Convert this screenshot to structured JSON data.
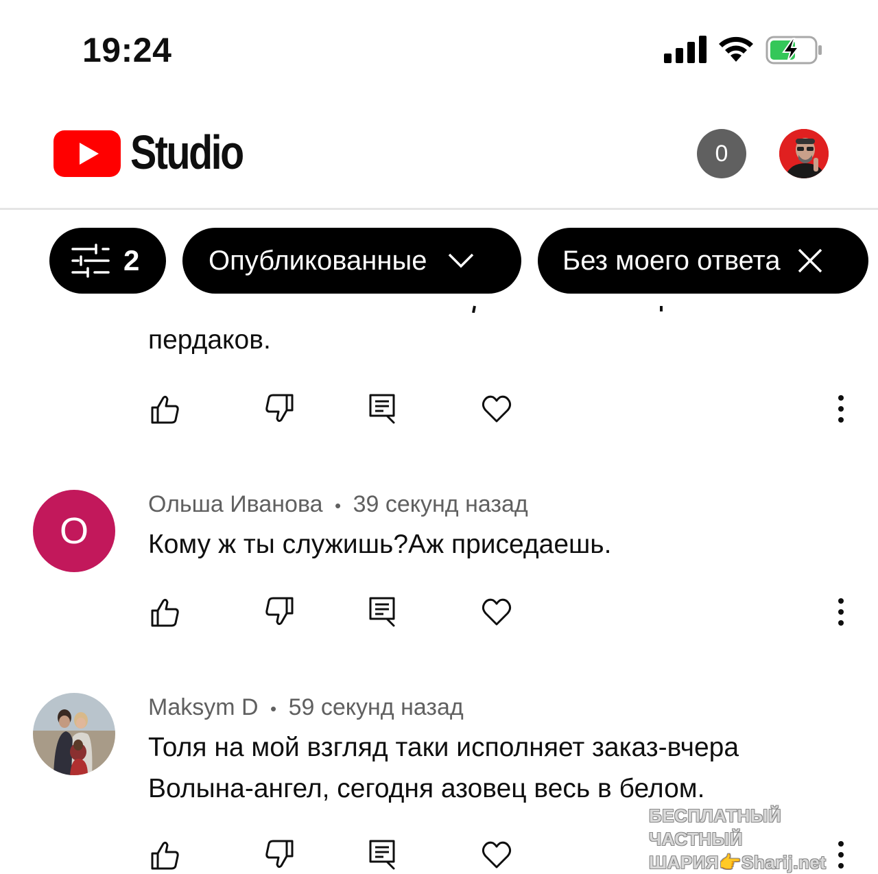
{
  "status_bar": {
    "time": "19:24",
    "icons": [
      "cellular-signal-icon",
      "wifi-icon",
      "battery-charging-icon"
    ],
    "battery_color": "#34c759"
  },
  "header": {
    "logo_text": "Studio",
    "notification_count": "0",
    "brand_color": "#ff0000"
  },
  "filters": {
    "filter_count": "2",
    "status_chip": "Опубликованные",
    "reply_chip": "Без моего ответа"
  },
  "comments": [
    {
      "author": "",
      "time": "",
      "text": "пердаков."
    },
    {
      "author": "Ольша Иванова",
      "separator": "•",
      "time": "39 секунд назад",
      "avatar_letter": "О",
      "avatar_color": "#c2185b",
      "text": "Кому ж ты служишь?Аж приседаешь."
    },
    {
      "author": "Maksym D",
      "separator": "•",
      "time": "59 секунд назад",
      "text_line1": "Толя на мой взгляд таки исполняет заказ-вчера",
      "text_line2": "Волына-ангел, сегодня азовец весь в белом."
    }
  ],
  "watermark": {
    "line1": "БЕСПЛАТНЫЙ ЧАСТНЫЙ",
    "line2": "ШАРИЯ👉Sharij.net"
  }
}
